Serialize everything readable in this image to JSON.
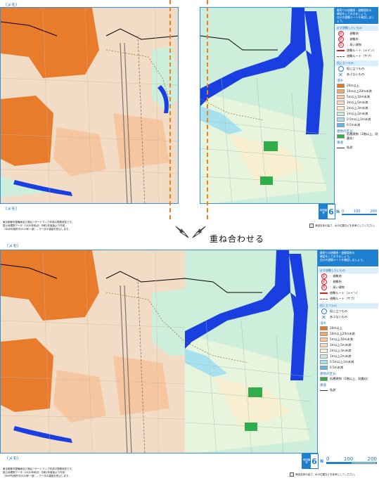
{
  "overlay_title": "重ね合わせる",
  "memo": "（メモ）",
  "legend": {
    "header_lines": [
      "最寄りの避難所・避難場所の",
      "確認をしておきましょう。",
      "自分の避難ルートを確認しましょう。"
    ],
    "sec_symbols": "必ず避難したいもの",
    "symbols": [
      {
        "glyph": "避",
        "label": "：避難地"
      },
      {
        "glyph": "避",
        "label": "：避難所"
      },
      {
        "glyph": "高",
        "label": "：高い建物"
      }
    ],
    "route_main": "避難ルート（メイン）",
    "route_sub": "避難ルート（サブ）",
    "sec_useful": "役に立つもの",
    "useful": "役に立つもの",
    "danger": "あぶないもの",
    "depth_head": "浸水",
    "depth": [
      {
        "label": "20m以上",
        "color": "#e0781f"
      },
      {
        "label": "10m以上20m未満",
        "color": "#f2a76a"
      },
      {
        "label": "5m以上10m未満",
        "color": "#f7c9a0"
      },
      {
        "label": "3m以上5m未満",
        "color": "#f4dcc0"
      },
      {
        "label": "2m以上3m未満",
        "color": "#f8efd0"
      },
      {
        "label": "1m以上2m未満",
        "color": "#c8ecd9"
      },
      {
        "label": "0.5m以上1m未満",
        "color": "#a7e0ef"
      },
      {
        "label": "0.5m未満",
        "color": "#5eb4ea"
      }
    ],
    "building_head": "建物の区分",
    "building_label": "低層建物（2階以上、耐震化）",
    "rail_head": "鉄道",
    "rail_label": "私鉄"
  },
  "footer": {
    "lines": [
      "東京都都市整備局及び港区ハザードマップ作成の表題改変です。",
      "国土地理院データ（2020年時点）令和2年度版より作成",
      "（MAP利用許可2019年一部）…データの複製を禁止します。"
    ],
    "note": "津波自体の高さ、水の位置などを参考にしてください。"
  },
  "pagebox": {
    "label": "地図番号",
    "number": "6"
  },
  "scale": {
    "zero": "0",
    "mid": "100",
    "max": "200",
    "unit": "m"
  },
  "north": "N",
  "colors": {
    "orange_area": "#e97b2c",
    "peach_area": "#f6c6a1",
    "light_green": "#cdeedb",
    "river_blue": "#1a3fe0",
    "accent_blue": "#1f7fd0",
    "dash_orange": "#ef7f1a"
  }
}
